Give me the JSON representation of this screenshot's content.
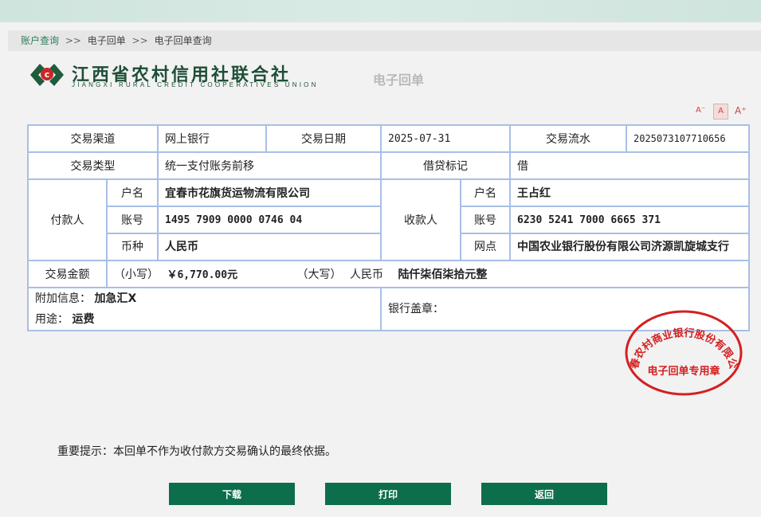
{
  "breadcrumb": {
    "items": [
      "账户查询",
      "电子回单",
      "电子回单查询"
    ],
    "separator": ">>"
  },
  "logo": {
    "name_cn": "江西省农村信用社联合社",
    "name_en": "JIANGXI RURAL CREDIT COOPERATIVES UNION"
  },
  "doc_title": "电子回单",
  "font_controls": {
    "small": "A⁻",
    "normal": "A",
    "large": "A⁺"
  },
  "receipt": {
    "channel_label": "交易渠道",
    "channel_value": "网上银行",
    "date_label": "交易日期",
    "date_value": "2025-07-31",
    "serial_label": "交易流水",
    "serial_value": "2025073107710656",
    "type_label": "交易类型",
    "type_value": "统一支付账务前移",
    "dc_label": "借贷标记",
    "dc_value": "借",
    "payer": {
      "label": "付款人",
      "name_label": "户名",
      "name_value": "宜春市花旗货运物流有限公司",
      "account_label": "账号",
      "account_value": "1495 7909 0000 0746 04",
      "currency_label": "币种",
      "currency_value": "人民币"
    },
    "payee": {
      "label": "收款人",
      "name_label": "户名",
      "name_value": "王占红",
      "account_label": "账号",
      "account_value": "6230 5241 7000 6665 371",
      "branch_label": "网点",
      "branch_value": "中国农业银行股份有限公司济源凯旋城支行"
    },
    "amount_label": "交易金额",
    "amount_small_label": "（小写）",
    "amount_small_value": "￥6,770.00元",
    "amount_big_label": "（大写）",
    "amount_big_currency": "人民币",
    "amount_big_value": "陆仟柒佰柒拾元整",
    "extra_label": "附加信息：",
    "extra_value": "加急汇X",
    "purpose_label": "用途：",
    "purpose_value": "运费",
    "stamp_label": "银行盖章：",
    "seal_text_top": "宜春农村商业银行股份有限公司",
    "seal_text_bottom": "电子回单专用章"
  },
  "notice": "重要提示：本回单不作为收付款方交易确认的最终依据。",
  "buttons": {
    "download": "下载",
    "print": "打印",
    "back": "返回"
  },
  "colors": {
    "accent": "#0d6e4b",
    "border": "#a8bfe6",
    "seal": "#d42020"
  }
}
